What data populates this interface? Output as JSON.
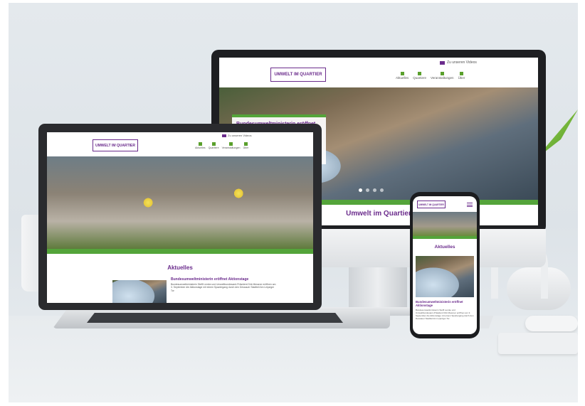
{
  "site": {
    "logo_text": "UMWELT IM QUARTIER",
    "video_link": "Zu unseren Videos",
    "nav": [
      "Aktuelles",
      "Quartiere",
      "Veranstaltungen",
      "Über"
    ],
    "banner_title": "Bundesumweltministerin eröffnet",
    "banner_text": "Bundesumweltministerin und ... Präsident",
    "page_heading": "Umwelt im Quartier",
    "section_heading": "Aktuelles",
    "article_title": "Bundesumweltministerin eröffnet Aktionstage",
    "article_text": "Bundesumweltministerin Steffi Lemke und Umweltbundesamt-Präsident Dirk Messner eröffnen am 3. September die Aktionstage mit einem Spaziergang durch den Dessauer Stadtteil Am Leipziger Tor",
    "phone_article_title": "Bundesumweltministerin eröffnet Aktionstage",
    "phone_article_text": "Bundesumweltministerin Steffi Lemke und Umweltbundesamt-Präsident Dirk Messner eröffnen am 3. September die Aktionstage mit einem Spaziergang durch den Dessauer Stadtteil Am Leipziger Tor"
  },
  "colors": {
    "purple": "#6b2c8c",
    "green": "#54a43a"
  }
}
